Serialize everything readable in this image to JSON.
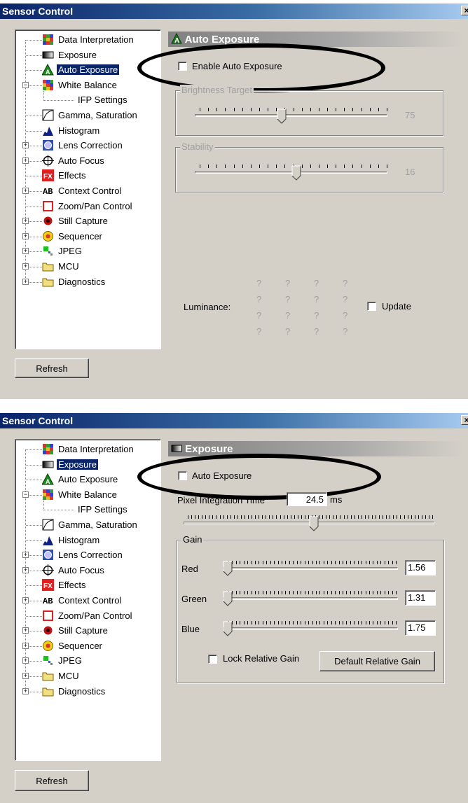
{
  "window_title": "Sensor Control",
  "close_glyph": "×",
  "tree_items": [
    {
      "label": "Data Interpretation",
      "icon": "data-interpretation-icon"
    },
    {
      "label": "Exposure",
      "icon": "exposure-icon"
    },
    {
      "label": "Auto Exposure",
      "icon": "auto-exposure-icon"
    },
    {
      "label": "White Balance",
      "icon": "white-balance-icon"
    },
    {
      "label": "IFP Settings",
      "icon": ""
    },
    {
      "label": "Gamma, Saturation",
      "icon": "gamma-icon"
    },
    {
      "label": "Histogram",
      "icon": "histogram-icon"
    },
    {
      "label": "Lens Correction",
      "icon": "lens-correction-icon"
    },
    {
      "label": "Auto Focus",
      "icon": "auto-focus-icon"
    },
    {
      "label": "Effects",
      "icon": "effects-icon"
    },
    {
      "label": "Context Control",
      "icon": "context-control-icon"
    },
    {
      "label": "Zoom/Pan Control",
      "icon": "zoom-pan-icon"
    },
    {
      "label": "Still Capture",
      "icon": "still-capture-icon"
    },
    {
      "label": "Sequencer",
      "icon": "sequencer-icon"
    },
    {
      "label": "JPEG",
      "icon": "jpeg-icon"
    },
    {
      "label": "MCU",
      "icon": "folder-icon"
    },
    {
      "label": "Diagnostics",
      "icon": "folder-icon"
    }
  ],
  "refresh_label": "Refresh",
  "panel1": {
    "header": "Auto Exposure",
    "selected_item": "Auto Exposure",
    "enable_label": "Enable Auto Exposure",
    "brightness_label": "Brightness Target",
    "brightness_value": "75",
    "brightness_level": 0.45,
    "stability_label": "Stability",
    "stability_value": "16",
    "stability_level": 0.53,
    "luminance_label": "Luminance:",
    "luminance_grid": [
      [
        "?",
        "?",
        "?",
        "?"
      ],
      [
        "?",
        "?",
        "?",
        "?"
      ],
      [
        "?",
        "?",
        "?",
        "?"
      ],
      [
        "?",
        "?",
        "?",
        "?"
      ]
    ],
    "update_label": "Update"
  },
  "panel2": {
    "header": "Exposure",
    "selected_item": "Exposure",
    "auto_label": "Auto Exposure",
    "pit_label": "Pixel Integration Time",
    "pit_value": "24.5",
    "pit_unit": "ms",
    "pit_level": 0.52,
    "gain_label": "Gain",
    "gains": [
      {
        "label": "Red",
        "value": "1.56"
      },
      {
        "label": "Green",
        "value": "1.31"
      },
      {
        "label": "Blue",
        "value": "1.75"
      }
    ],
    "lock_label": "Lock Relative Gain",
    "default_label": "Default Relative Gain"
  }
}
